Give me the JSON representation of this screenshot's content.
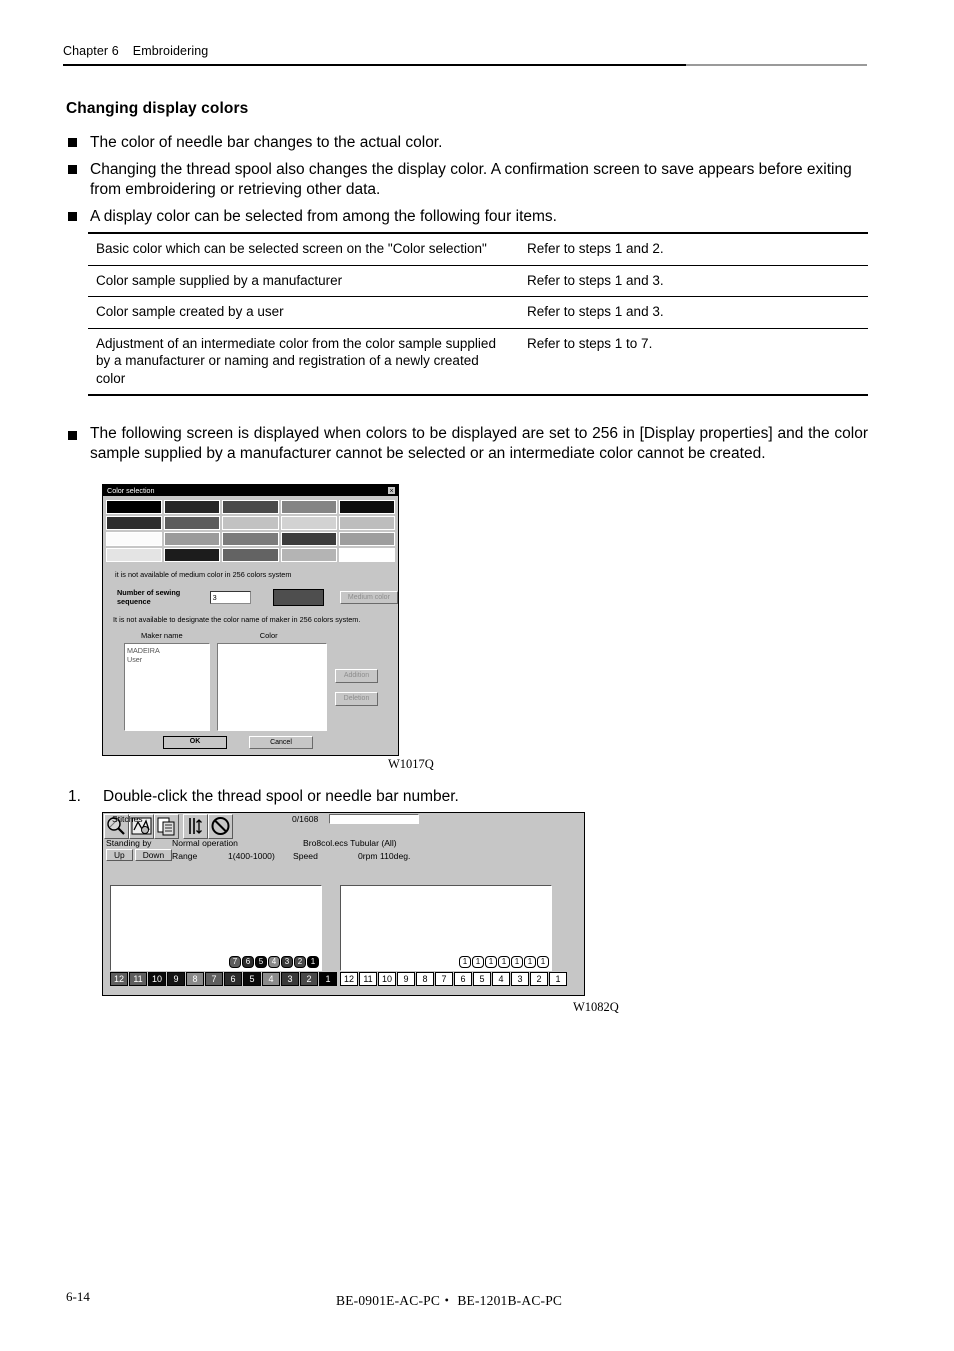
{
  "header": {
    "chapter": "Chapter 6",
    "title": "Embroidering"
  },
  "section": {
    "heading": "Changing display colors"
  },
  "bullets": [
    {
      "text": "The color of needle bar changes to the actual color."
    },
    {
      "text": "Changing the thread spool also changes the display color.    A confirmation screen to save appears before exiting from embroidering or retrieving other data."
    },
    {
      "text": "A display color can be selected from among the following four items."
    },
    {
      "text": "The following screen is displayed when colors to be displayed are set to 256 in [Display properties] and the color sample supplied by a manufacturer cannot be selected or an intermediate color cannot be created."
    }
  ],
  "table": {
    "rows": [
      {
        "item": "Basic color which can be selected screen on the \"Color selection\"",
        "ref": "Refer to steps 1 and 2."
      },
      {
        "item": "Color sample supplied by a manufacturer",
        "ref": "Refer to steps 1 and 3."
      },
      {
        "item": "Color sample created by a user",
        "ref": "Refer to steps 1 and 3."
      },
      {
        "item": "Adjustment of an intermediate color from the color sample supplied by a manufacturer or naming and registration of a newly created color",
        "ref": "Refer to steps 1 to 7."
      }
    ]
  },
  "figure1": {
    "caption": "W1017Q",
    "title": "Color selection",
    "close_label": "×",
    "swatches": [
      "#000000",
      "#262626",
      "#4a4a4a",
      "#848484",
      "#0d0d0d",
      "#2e2e2e",
      "#5c5c5c",
      "#c2c2c2",
      "#d2d2d2",
      "#bdbdbd",
      "#fbfbfb",
      "#9b9b9b",
      "#7b7b7b",
      "#3c3c3c",
      "#9e9e9e",
      "#e4e4e4",
      "#1c1c1c",
      "#636363",
      "#b4b4b4",
      "#ffffff"
    ],
    "message_medium": "it is not available of medium color in 256 colors system",
    "sequence_label": "Number of sewing sequence",
    "sequence_value": "3",
    "preview_color": "#4e4e4e",
    "medium_color_button": "Medium color",
    "message_maker": "It is not available to designate the color name of maker in 256 colors system.",
    "maker_name_label": "Maker name",
    "color_label": "Color",
    "maker_list": [
      "MADEIRA",
      "User"
    ],
    "addition_button": "Addition",
    "deletion_button": "Deletion",
    "ok_button": "OK",
    "cancel_button": "Cancel"
  },
  "step1": {
    "number": "1.",
    "text": "Double-click the thread spool or needle bar number."
  },
  "figure2": {
    "caption": "W1082Q",
    "toolbar_icons": [
      "magnifier-icon",
      "design-icon",
      "copy-icon",
      "needle-icon",
      "prohibit-icon"
    ],
    "stitches_label": "Stitches",
    "stitches_value": "0/1608",
    "status_label": "Standing by",
    "operation_label": "Normal operation",
    "design_label": "Bro8col.ecs Tubular (All)",
    "up_button": "Up",
    "down_button": "Down",
    "range_label": "Range",
    "range_value": "1(400-1000)",
    "speed_label": "Speed",
    "speed_value": "0rpm 110deg.",
    "left_panel": {
      "spools": [
        {
          "label": "7",
          "color": "#5e5e5e",
          "text": "#ffffff"
        },
        {
          "label": "6",
          "color": "#2b2b2b",
          "text": "#ffffff"
        },
        {
          "label": "5",
          "color": "#0a0a0a",
          "text": "#ffffff"
        },
        {
          "label": "4",
          "color": "#8a8a8a",
          "text": "#ffffff"
        },
        {
          "label": "3",
          "color": "#3a3a3a",
          "text": "#ffffff"
        },
        {
          "label": "2",
          "color": "#4a4a4a",
          "text": "#ffffff"
        },
        {
          "label": "1",
          "color": "#000000",
          "text": "#ffffff"
        }
      ],
      "bars": [
        {
          "label": "12",
          "color": "#5e5e5e",
          "text": "#ffffff"
        },
        {
          "label": "11",
          "color": "#5e5e5e",
          "text": "#ffffff"
        },
        {
          "label": "10",
          "color": "#0a0a0a",
          "text": "#ffffff"
        },
        {
          "label": "9",
          "color": "#141414",
          "text": "#ffffff"
        },
        {
          "label": "8",
          "color": "#8a8a8a",
          "text": "#ffffff"
        },
        {
          "label": "7",
          "color": "#5e5e5e",
          "text": "#ffffff"
        },
        {
          "label": "6",
          "color": "#2b2b2b",
          "text": "#ffffff"
        },
        {
          "label": "5",
          "color": "#0a0a0a",
          "text": "#ffffff"
        },
        {
          "label": "4",
          "color": "#8a8a8a",
          "text": "#ffffff"
        },
        {
          "label": "3",
          "color": "#3a3a3a",
          "text": "#ffffff"
        },
        {
          "label": "2",
          "color": "#4a4a4a",
          "text": "#ffffff"
        },
        {
          "label": "1",
          "color": "#000000",
          "text": "#ffffff"
        }
      ]
    },
    "right_panel": {
      "spools": [
        {
          "label": "1",
          "color": "#ffffff",
          "text": "#000000"
        },
        {
          "label": "1",
          "color": "#ffffff",
          "text": "#000000"
        },
        {
          "label": "1",
          "color": "#ffffff",
          "text": "#000000"
        },
        {
          "label": "1",
          "color": "#ffffff",
          "text": "#000000"
        },
        {
          "label": "1",
          "color": "#ffffff",
          "text": "#000000"
        },
        {
          "label": "1",
          "color": "#ffffff",
          "text": "#000000"
        },
        {
          "label": "1",
          "color": "#ffffff",
          "text": "#000000"
        }
      ],
      "bars": [
        {
          "label": "12",
          "color": "#ffffff",
          "text": "#000000"
        },
        {
          "label": "11",
          "color": "#ffffff",
          "text": "#000000"
        },
        {
          "label": "10",
          "color": "#ffffff",
          "text": "#000000"
        },
        {
          "label": "9",
          "color": "#ffffff",
          "text": "#000000"
        },
        {
          "label": "8",
          "color": "#ffffff",
          "text": "#000000"
        },
        {
          "label": "7",
          "color": "#ffffff",
          "text": "#000000"
        },
        {
          "label": "6",
          "color": "#ffffff",
          "text": "#000000"
        },
        {
          "label": "5",
          "color": "#ffffff",
          "text": "#000000"
        },
        {
          "label": "4",
          "color": "#ffffff",
          "text": "#000000"
        },
        {
          "label": "3",
          "color": "#ffffff",
          "text": "#000000"
        },
        {
          "label": "2",
          "color": "#ffffff",
          "text": "#000000"
        },
        {
          "label": "1",
          "color": "#ffffff",
          "text": "#000000"
        }
      ]
    }
  },
  "footer": {
    "page": "6-14",
    "models": "BE-0901E-AC-PC・ BE-1201B-AC-PC"
  }
}
